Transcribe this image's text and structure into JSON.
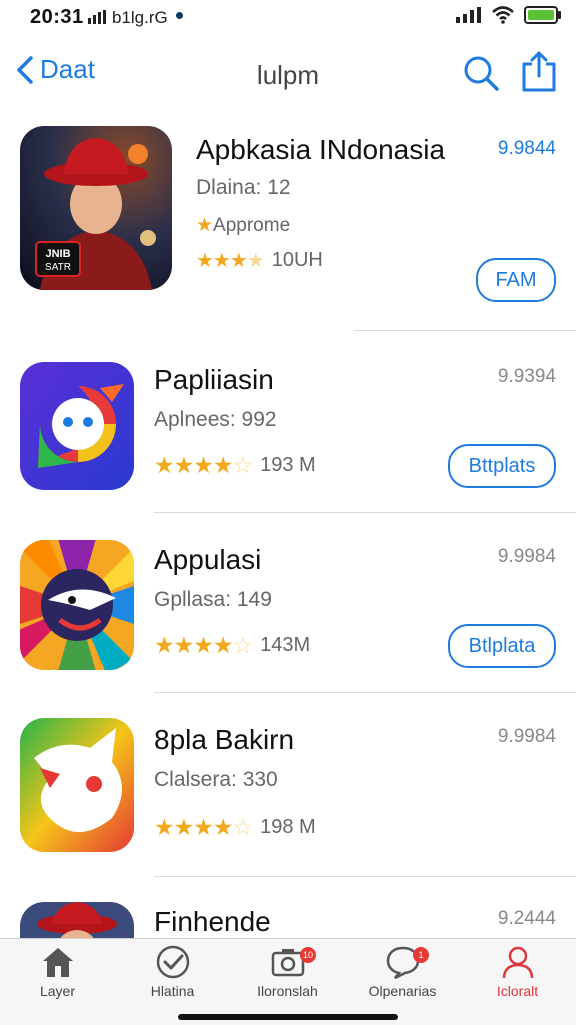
{
  "status": {
    "time": "20:31",
    "carrier": "b1lg.rG"
  },
  "nav": {
    "back_label": "Daat",
    "title": "lulpm"
  },
  "apps": [
    {
      "name": "Apbkasia INdonasia",
      "subtitle": "Dlaina: 12",
      "tag": "Approme",
      "rating_count": "10UH",
      "stars": 3.5,
      "price": "9.9844",
      "button": "FAM"
    },
    {
      "name": "Papliiasin",
      "subtitle": "Aplnees: 992",
      "rating_count": "193 M",
      "stars": 4.5,
      "price": "9.9394",
      "button": "Bttplats"
    },
    {
      "name": "Appulasi",
      "subtitle": "Gpllasa: 149",
      "rating_count": "143M",
      "stars": 4.5,
      "price": "9.9984",
      "button": "Btlplata"
    },
    {
      "name": "8pla Bakirn",
      "subtitle": "Clalsera: 330",
      "rating_count": "198 M",
      "stars": 4.5,
      "price": "9.9984"
    },
    {
      "name": "Finhende",
      "price": "9.2444"
    }
  ],
  "tabs": [
    {
      "label": "Layer",
      "icon": "home-icon"
    },
    {
      "label": "Hlatina",
      "icon": "check-circle-icon"
    },
    {
      "label": "Iloronslah",
      "icon": "camera-icon",
      "badge": "10"
    },
    {
      "label": "Olpenarias",
      "icon": "chat-icon",
      "badge": "1"
    },
    {
      "label": "Icloralt",
      "icon": "person-icon",
      "active": true
    }
  ],
  "colors": {
    "accent": "#1e7be0",
    "star": "#f2a91d",
    "active_tab": "#d9363e"
  }
}
